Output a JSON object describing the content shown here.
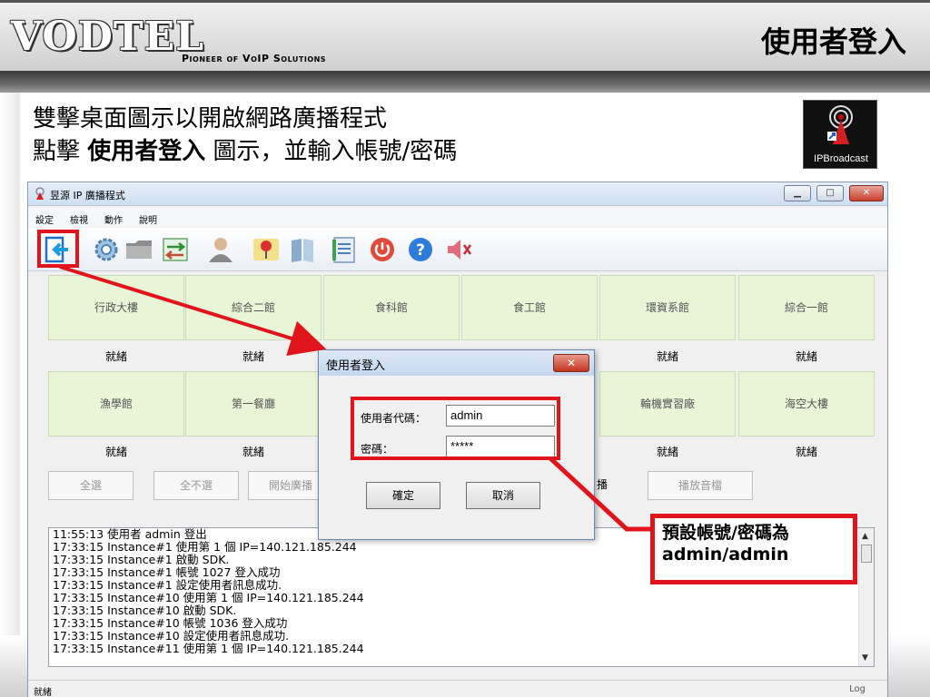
{
  "slide": {
    "logo": "VODTEL",
    "tagline": "Pioneer of VoIP Solutions",
    "title": "使用者登入",
    "instruction_line1": "雙擊桌面圖示以開啟網路廣播程式",
    "instruction_line2_pre": "點擊 ",
    "instruction_line2_bold": "使用者登入",
    "instruction_line2_post": " 圖示，並輸入帳號/密碼",
    "desktop_icon_label": "IPBroadcast"
  },
  "window": {
    "title": "昱源 IP 廣播程式",
    "menu": [
      "設定",
      "檢視",
      "動作",
      "說明"
    ],
    "toolbar_icons": [
      "login-icon",
      "settings-gear-icon",
      "folder-icon",
      "transfer-icon",
      "user-icon",
      "map-pin-icon",
      "book-icon",
      "notepad-icon",
      "power-icon",
      "help-icon",
      "mute-speaker-icon"
    ],
    "buildings_row1": [
      "行政大樓",
      "綜合二館",
      "食科館",
      "食工館",
      "環資系館",
      "綜合一館"
    ],
    "status_row1": [
      "就緒",
      "就緒",
      "",
      "",
      "就緒",
      "就緒"
    ],
    "buildings_row2": [
      "漁學館",
      "第一餐廳",
      "",
      "",
      "輪機實習廠",
      "海空大樓"
    ],
    "status_row2": [
      "就緒",
      "就緒",
      "",
      "",
      "就緒",
      "就緒"
    ],
    "controls": [
      "全選",
      "全不選",
      "開始廣播",
      "播放音檔"
    ],
    "controls_partial_char": "播",
    "log": [
      "11:55:13 使用者 admin 登出",
      "17:33:15 Instance#1 使用第 1 個 IP=140.121.185.244",
      "17:33:15 Instance#1 啟動 SDK.",
      "17:33:15 Instance#1 帳號 1027 登入成功",
      "17:33:15 Instance#1 設定使用者訊息成功.",
      "17:33:15 Instance#10 使用第 1 個 IP=140.121.185.244",
      "17:33:15 Instance#10 啟動 SDK.",
      "17:33:15 Instance#10 帳號 1036 登入成功",
      "17:33:15 Instance#10 設定使用者訊息成功.",
      "17:33:15 Instance#11 使用第 1 個 IP=140.121.185.244"
    ],
    "status_left": "就緒",
    "status_right": "Log"
  },
  "dialog": {
    "title": "使用者登入",
    "user_label": "使用者代碼：",
    "user_value": "admin",
    "password_label": "密碼：",
    "password_value": "*****",
    "ok": "確定",
    "cancel": "取消"
  },
  "callout": {
    "line1": "預設帳號/密碼為",
    "line2": "admin/admin"
  },
  "colors": {
    "highlight": "#e1141b",
    "building_bg": "#e9f5d7"
  }
}
